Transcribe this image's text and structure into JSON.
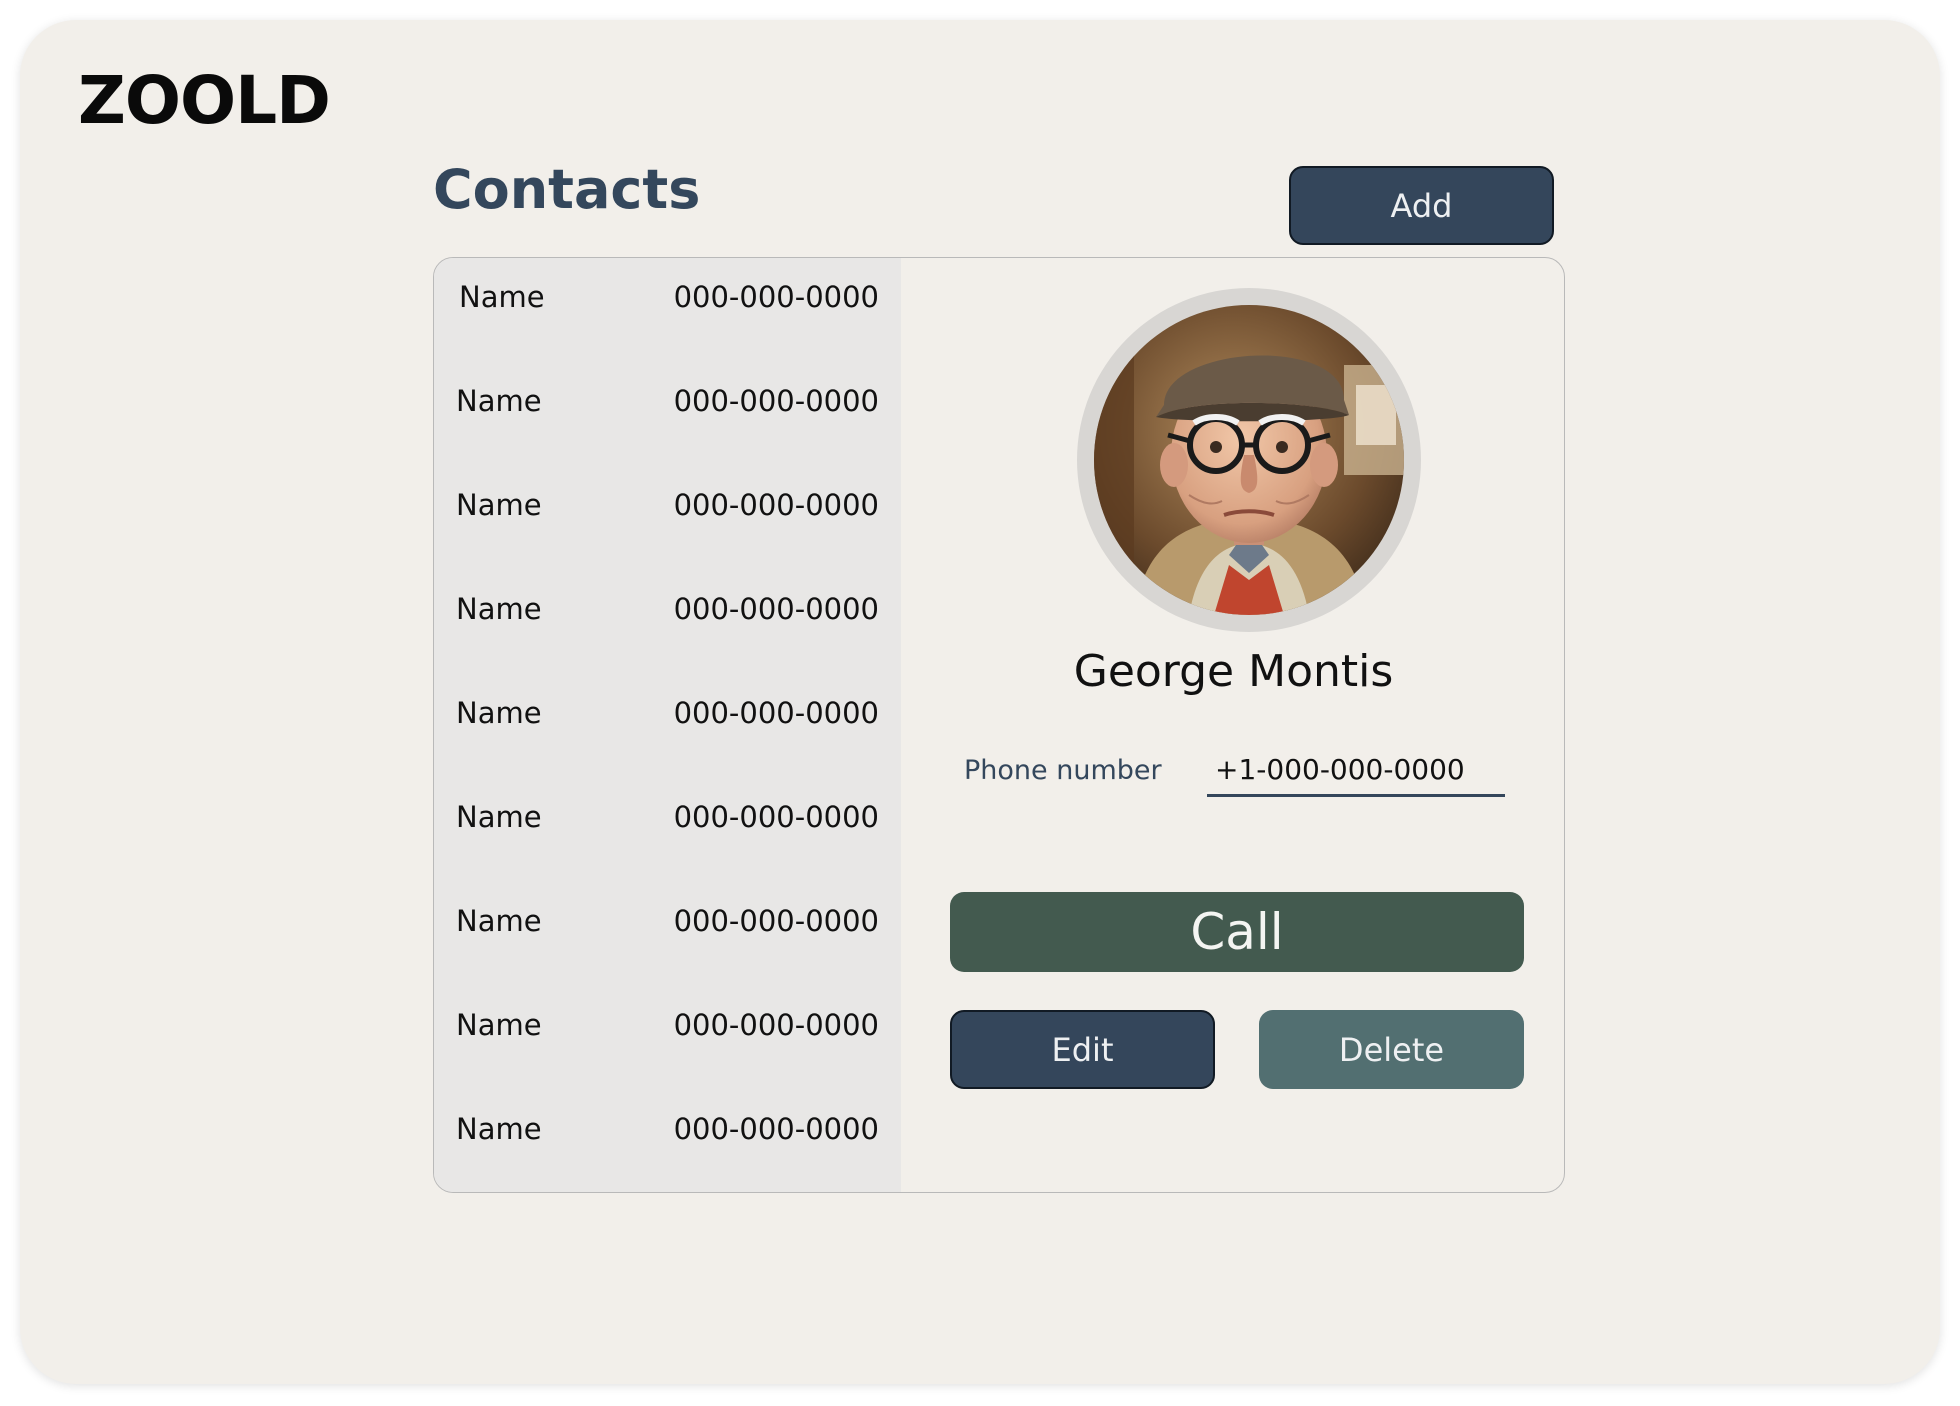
{
  "app": {
    "logo": "ZOOLD"
  },
  "header": {
    "title": "Contacts",
    "add_label": "Add"
  },
  "contacts": [
    {
      "name": "Name",
      "phone": "000-000-0000"
    },
    {
      "name": "Name",
      "phone": "000-000-0000"
    },
    {
      "name": "Name",
      "phone": "000-000-0000"
    },
    {
      "name": "Name",
      "phone": "000-000-0000"
    },
    {
      "name": "Name",
      "phone": "000-000-0000"
    },
    {
      "name": "Name",
      "phone": "000-000-0000"
    },
    {
      "name": "Name",
      "phone": "000-000-0000"
    },
    {
      "name": "Name",
      "phone": "000-000-0000"
    },
    {
      "name": "Name",
      "phone": "000-000-0000"
    }
  ],
  "detail": {
    "name": "George Montis",
    "phone_label": "Phone number",
    "phone_value": "+1-000-000-0000",
    "call_label": "Call",
    "edit_label": "Edit",
    "delete_label": "Delete"
  },
  "colors": {
    "background": "#f2efea",
    "list_background": "#e8e7e6",
    "primary": "#34465b",
    "call": "#435a4f",
    "delete": "#526f71"
  }
}
